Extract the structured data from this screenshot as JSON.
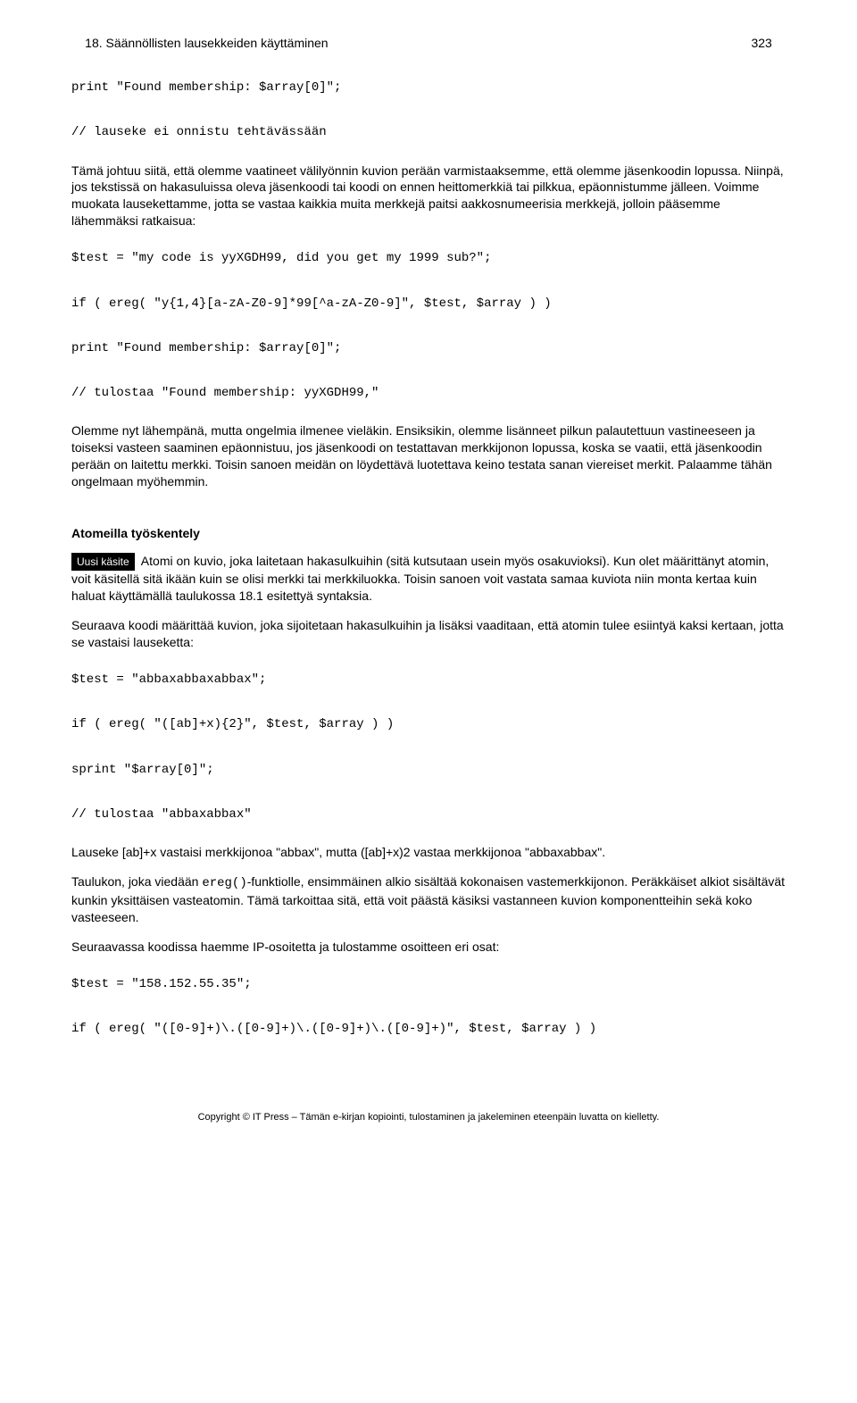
{
  "header": {
    "title": "18. Säännöllisten lausekkeiden käyttäminen",
    "page": "323"
  },
  "code1": "print \"Found membership: $array[0]\";\n\n// lauseke ei onnistu tehtävässään",
  "para1": "Tämä johtuu siitä, että olemme vaatineet välilyönnin kuvion perään varmistaaksemme, että olemme jäsenkoodin lopussa. Niinpä, jos tekstissä on hakasuluissa oleva jäsenkoodi tai koodi on ennen heittomerkkiä tai pilkkua, epäonnistumme jälleen. Voimme muokata lausekettamme, jotta se vastaa kaikkia muita merkkejä paitsi aakkosnumeerisia merkkejä, jolloin pääsemme lähemmäksi ratkaisua:",
  "code2": "$test = \"my code is yyXGDH99, did you get my 1999 sub?\";\n\nif ( ereg( \"y{1,4}[a-zA-Z0-9]*99[^a-zA-Z0-9]\", $test, $array ) )\n\nprint \"Found membership: $array[0]\";\n\n// tulostaa \"Found membership: yyXGDH99,\"",
  "para2": "Olemme nyt lähempänä, mutta ongelmia ilmenee vieläkin. Ensiksikin, olemme lisänneet pilkun palautettuun vastineeseen ja toiseksi vasteen saaminen epäonnistuu, jos jäsenkoodi on testattavan merkkijonon lopussa, koska se vaatii, että jäsenkoodin perään on laitettu merkki. Toisin sanoen meidän on löydettävä luotettava keino testata sanan viereiset merkit. Palaamme tähän ongelmaan myöhemmin.",
  "section_title": "Atomeilla työskentely",
  "badge": "Uusi käsite",
  "para3": " Atomi on kuvio, joka laitetaan hakasulkuihin (sitä kutsutaan usein myös osakuvioksi). Kun olet määrittänyt atomin, voit käsitellä sitä ikään kuin se olisi merkki tai merkkiluokka. Toisin sanoen voit vastata samaa kuviota niin monta kertaa kuin haluat käyttämällä taulukossa 18.1 esitettyä syntaksia.",
  "para4": "Seuraava koodi määrittää kuvion, joka sijoitetaan hakasulkuihin ja lisäksi vaaditaan, että atomin tulee esiintyä kaksi kertaan, jotta se vastaisi lauseketta:",
  "code3": "$test = \"abbaxabbaxabbax\";\n\nif ( ereg( \"([ab]+x){2}\", $test, $array ) )\n\nsprint \"$array[0]\";\n\n// tulostaa \"abbaxabbax\"",
  "para5": "Lauseke [ab]+x vastaisi merkkijonoa \"abbax\", mutta ([ab]+x)2 vastaa merkkijonoa \"abbaxabbax\".",
  "para6a": "Taulukon, joka viedään ",
  "para6_mono": "ereg()",
  "para6b": "-funktiolle, ensimmäinen alkio sisältää kokonaisen vastemerkkijonon. Peräkkäiset alkiot sisältävät kunkin yksittäisen vasteatomin. Tämä tarkoittaa sitä, että voit päästä käsiksi vastanneen kuvion komponentteihin sekä koko vasteeseen.",
  "para7": "Seuraavassa koodissa haemme IP-osoitetta ja tulostamme osoitteen eri osat:",
  "code4": "$test = \"158.152.55.35\";\n\nif ( ereg( \"([0-9]+)\\.([0-9]+)\\.([0-9]+)\\.([0-9]+)\", $test, $array ) )",
  "footer": "Copyright © IT Press – Tämän e-kirjan kopiointi, tulostaminen ja jakeleminen eteenpäin luvatta on kielletty."
}
